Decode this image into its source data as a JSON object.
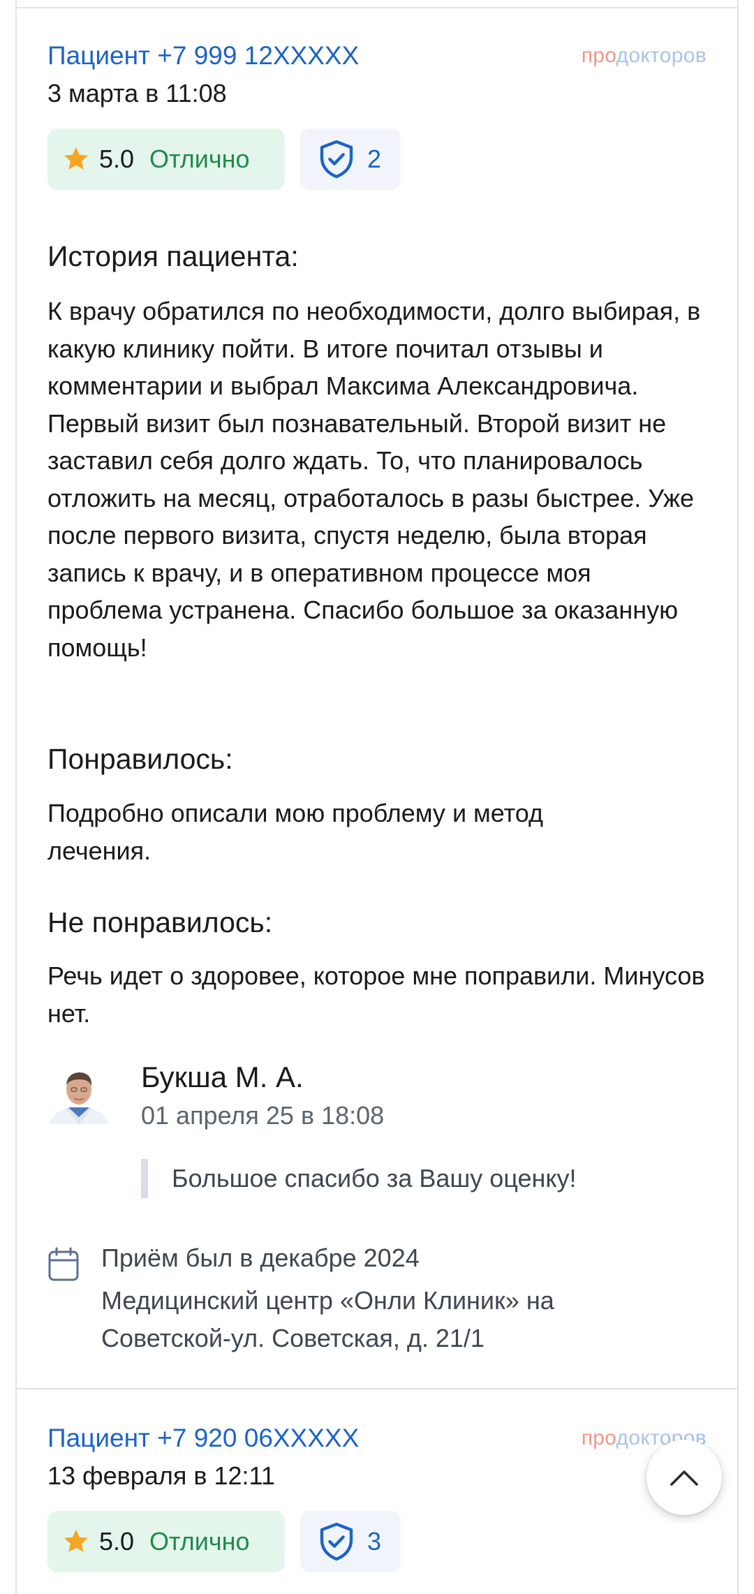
{
  "brand": {
    "prefix": "про",
    "suffix": "докторов"
  },
  "reviews": [
    {
      "author": "Пациент +7 999 12XXXXX",
      "date": "3 марта в 11:08",
      "rating": {
        "score": "5.0",
        "label": "Отлично",
        "value": 5.0,
        "max": 5
      },
      "verified_count": "2",
      "story_title": "История пациента:",
      "story": "К врачу обратился по необходимости, долго выбирая, в какую клинику пойти. В итоге почитал отзывы и комментарии и выбрал Максима Александровича. Первый визит был познавательный. Второй визит не заставил себя долго ждать. То, что планировалось отложить на месяц, отработалось в разы быстрее. Уже после первого визита, спустя неделю, была вторая запись к врачу, и в оперативном процессе моя проблема устранена. Спасибо большое за оказанную помощь!",
      "liked_title": "Понравилось:",
      "liked": "Подробно описали мою проблему и метод лечения.",
      "disliked_title": "Не понравилось:",
      "disliked": "Речь идет о здоровее, которое мне поправили. Минусов нет.",
      "reply": {
        "name": "Букша М. А.",
        "date": "01 апреля 25 в 18:08",
        "text": "Большое спасибо за Вашу оценку!"
      },
      "visit": {
        "date": "Приём был в декабре 2024",
        "clinic": "Медицинский центр «Онли Клиник» на Советской-ул. Советская, д. 21/1"
      }
    },
    {
      "author": "Пациент +7 920 06XXXXX",
      "date": "13 февраля в 12:11",
      "rating": {
        "score": "5.0",
        "label": "Отлично",
        "value": 5.0,
        "max": 5
      },
      "verified_count": "3"
    }
  ],
  "colors": {
    "link": "#1c63c6",
    "rating_bg": "#e4f6ec",
    "rating_text": "#1f8a4c",
    "star": "#f5a623",
    "shield": "#1c63c6",
    "trust_bg": "#f1f5fb"
  },
  "icons": {
    "star": "star-icon",
    "shield": "shield-check-icon",
    "calendar": "calendar-icon",
    "scroll_top": "chevron-up-icon"
  }
}
